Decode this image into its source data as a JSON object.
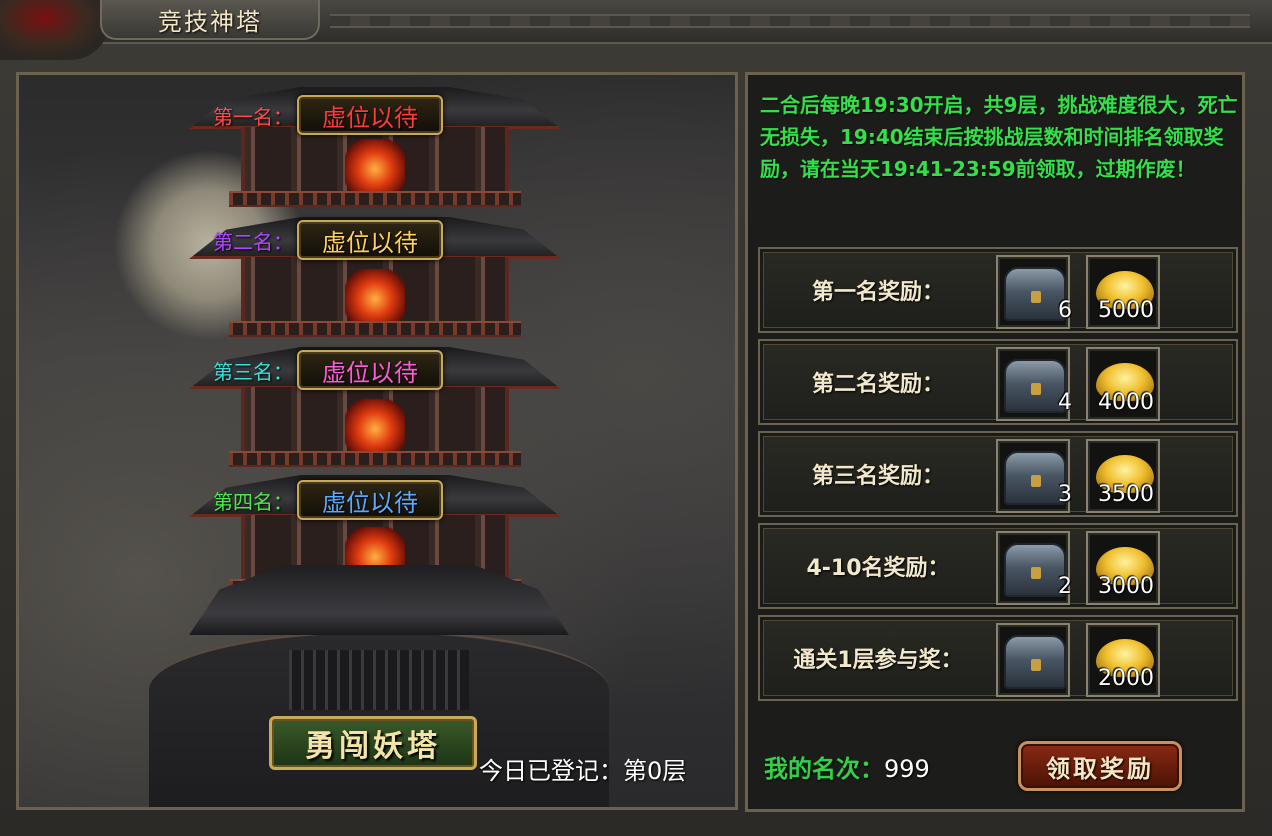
{
  "window": {
    "title": "竞技神塔"
  },
  "ranks": [
    {
      "label": "第一名：",
      "value": "虚位以待",
      "label_color": "#ff4b4b",
      "value_color": "#ff3a3a"
    },
    {
      "label": "第二名：",
      "value": "虚位以待",
      "label_color": "#b048ff",
      "value_color": "#ffd060"
    },
    {
      "label": "第三名：",
      "value": "虚位以待",
      "label_color": "#3ae0d8",
      "value_color": "#ff5ad8"
    },
    {
      "label": "第四名：",
      "value": "虚位以待",
      "label_color": "#4aea4a",
      "value_color": "#5aaaff"
    }
  ],
  "challenge_button": "勇闯妖塔",
  "registered_text": "今日已登记：第0层",
  "info_text": "二合后每晚19:30开启，共9层，挑战难度很大，死亡无损失，19:40结束后按挑战层数和时间排名领取奖励，请在当天19:41-23:59前领取，过期作废！",
  "rewards": [
    {
      "label": "第一名奖励：",
      "chest_icon": "treasure-chest-icon",
      "chest_count": "6",
      "gold_icon": "gold-ingot-icon",
      "gold_count": "5000"
    },
    {
      "label": "第二名奖励：",
      "chest_icon": "treasure-chest-icon",
      "chest_count": "4",
      "gold_icon": "gold-ingot-icon",
      "gold_count": "4000"
    },
    {
      "label": "第三名奖励：",
      "chest_icon": "treasure-chest-icon",
      "chest_count": "3",
      "gold_icon": "gold-ingot-icon",
      "gold_count": "3500"
    },
    {
      "label": "4-10名奖励：",
      "chest_icon": "treasure-chest-icon",
      "chest_count": "2",
      "gold_icon": "gold-ingot-icon",
      "gold_count": "3000"
    },
    {
      "label": "通关1层参与奖：",
      "chest_icon": "treasure-chest-icon",
      "chest_count": "",
      "gold_icon": "gold-ingot-icon",
      "gold_count": "2000"
    }
  ],
  "my_rank": {
    "label": "我的名次：",
    "value": "999"
  },
  "claim_button": "领取奖励",
  "colors": {
    "info_text": "#33e04a",
    "gold_border": "#c8a85a",
    "claim_button": "#8a2a14",
    "challenge_button": "#3a5a2a"
  }
}
